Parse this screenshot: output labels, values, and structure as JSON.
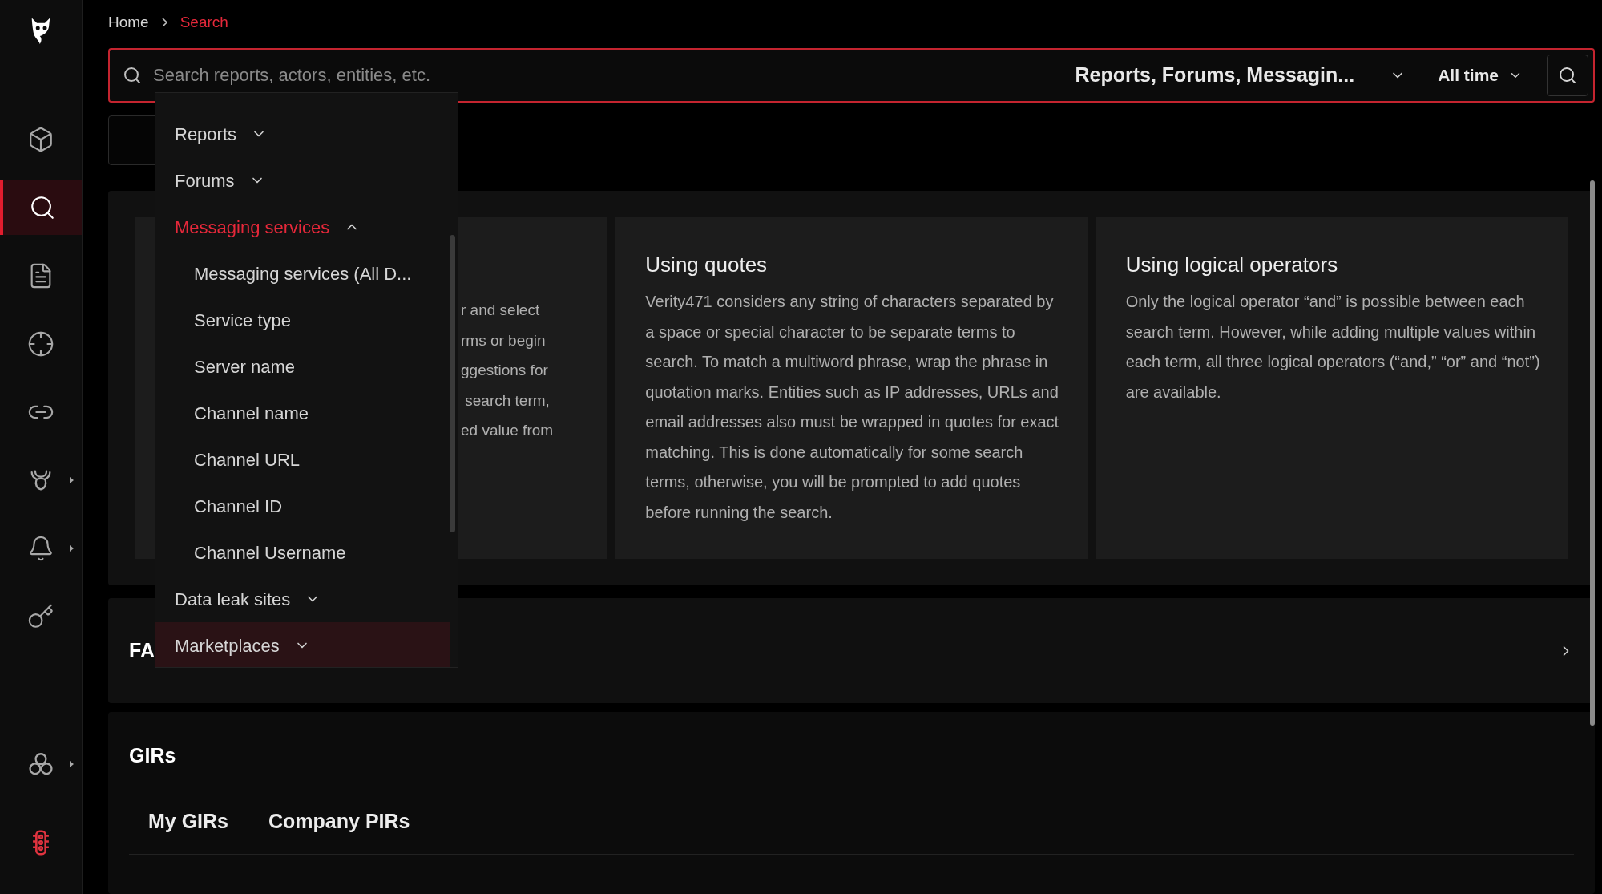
{
  "sidebar": {
    "items": [
      {
        "kind": "box",
        "selected": false,
        "submenu": false
      },
      {
        "kind": "search",
        "selected": true,
        "submenu": false
      },
      {
        "kind": "document",
        "selected": false,
        "submenu": false
      },
      {
        "kind": "crosshair",
        "selected": false,
        "submenu": false
      },
      {
        "kind": "link",
        "selected": false,
        "submenu": false
      },
      {
        "kind": "creature",
        "selected": false,
        "submenu": true
      },
      {
        "kind": "bell",
        "selected": false,
        "submenu": true
      },
      {
        "kind": "key",
        "selected": false,
        "submenu": false
      }
    ],
    "bottom_items": [
      {
        "kind": "circles",
        "selected": false,
        "submenu": true
      },
      {
        "kind": "traffic",
        "selected": false,
        "submenu": false
      }
    ]
  },
  "breadcrumb": [
    {
      "label": "Home",
      "current": false
    },
    {
      "label": "Search",
      "current": true
    }
  ],
  "search": {
    "placeholder": "Search reports, actors, entities, etc.",
    "scope": "Reports, Forums, Messagin...",
    "time": "All time"
  },
  "scope_menu": [
    {
      "label": "Reports",
      "expanded": false,
      "highlighted": false
    },
    {
      "label": "Forums",
      "expanded": false,
      "highlighted": false
    },
    {
      "label": "Messaging services",
      "expanded": true,
      "highlighted": false,
      "children": [
        {
          "label": "Messaging services (All D..."
        },
        {
          "label": "Service type"
        },
        {
          "label": "Server name"
        },
        {
          "label": "Channel name"
        },
        {
          "label": "Channel URL"
        },
        {
          "label": "Channel ID"
        },
        {
          "label": "Channel Username"
        }
      ]
    },
    {
      "label": "Data leak sites",
      "expanded": false,
      "highlighted": false
    },
    {
      "label": "Marketplaces",
      "expanded": false,
      "highlighted": true
    }
  ],
  "tips": [
    {
      "lines": [
        "r and select",
        "rms or begin",
        "ggestions for",
        " search term,",
        "ed value from"
      ]
    },
    {
      "title": "Using quotes",
      "body": "Verity471 considers any string of characters separated by a space or special character to be separate terms to search. To match a multiword phrase, wrap the phrase in quotation marks. Entities such as IP addresses, URLs and email addresses also must be wrapped in quotes for exact matching. This is done automatically for some search terms, otherwise, you will be prompted to add quotes before running the search."
    },
    {
      "title": "Using logical operators",
      "body": "Only the logical operator “and” is possible between each search term. However, while adding multiple values within each term, all three logical operators (“and,” “or” and “not”) are available."
    }
  ],
  "faq": {
    "title": "FA"
  },
  "girs": {
    "title": "GIRs",
    "tabs": [
      "My GIRs",
      "Company PIRs"
    ]
  }
}
